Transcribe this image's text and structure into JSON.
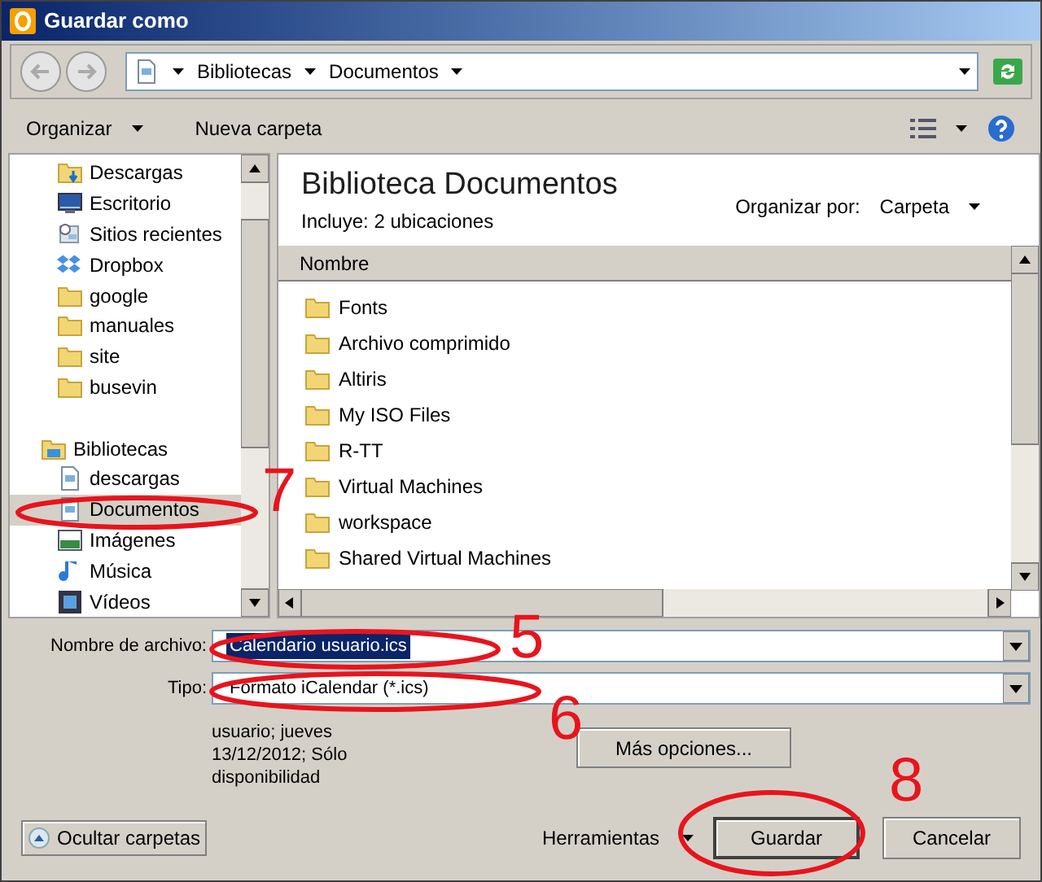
{
  "window": {
    "title": "Guardar como"
  },
  "address_bar": {
    "crumbs": [
      "Bibliotecas",
      "Documentos"
    ]
  },
  "toolbar": {
    "organize": "Organizar",
    "new_folder": "Nueva carpeta"
  },
  "sidebar": {
    "favorites": [
      {
        "label": "Descargas",
        "kind": "downloads",
        "selected": false
      },
      {
        "label": "Escritorio",
        "kind": "desktop",
        "selected": false
      },
      {
        "label": "Sitios recientes",
        "kind": "recent",
        "selected": false
      },
      {
        "label": "Dropbox",
        "kind": "dropbox",
        "selected": false
      },
      {
        "label": "google",
        "kind": "folder",
        "selected": false
      },
      {
        "label": "manuales",
        "kind": "folder",
        "selected": false
      },
      {
        "label": "site",
        "kind": "folder",
        "selected": false
      },
      {
        "label": "busevin",
        "kind": "folder",
        "selected": false
      }
    ],
    "libraries": {
      "label": "Bibliotecas",
      "selected": false,
      "children": [
        {
          "label": "descargas",
          "kind": "document",
          "selected": false
        },
        {
          "label": "Documentos",
          "kind": "document",
          "selected": true
        },
        {
          "label": "Imágenes",
          "kind": "pictures",
          "selected": false
        },
        {
          "label": "Música",
          "kind": "music",
          "selected": false
        },
        {
          "label": "Vídeos",
          "kind": "video",
          "selected": false
        }
      ]
    }
  },
  "content": {
    "title": "Biblioteca Documentos",
    "subtitle": "Incluye:  2 ubicaciones",
    "arrange_label": "Organizar por:",
    "arrange_value": "Carpeta",
    "column": "Nombre",
    "files": [
      "Fonts",
      "Archivo comprimido",
      "Altiris",
      "My ISO Files",
      "R-TT",
      "Virtual Machines",
      "workspace",
      "Shared Virtual Machines"
    ]
  },
  "form": {
    "filename_label": "Nombre de archivo:",
    "filename": "Calendario usuario.ics",
    "filename_selected": true,
    "type_label": "Tipo:",
    "type": "Formato iCalendar (*.ics)",
    "info": "usuario; jueves 13/12/2012; Sólo disponibilidad",
    "more_options": "Más opciones..."
  },
  "footer": {
    "hide_folders": "Ocultar carpetas",
    "tools": "Herramientas",
    "save": "Guardar",
    "cancel": "Cancelar"
  },
  "annotations": [
    {
      "label": "5"
    },
    {
      "label": "6"
    },
    {
      "label": "7"
    },
    {
      "label": "8"
    }
  ]
}
